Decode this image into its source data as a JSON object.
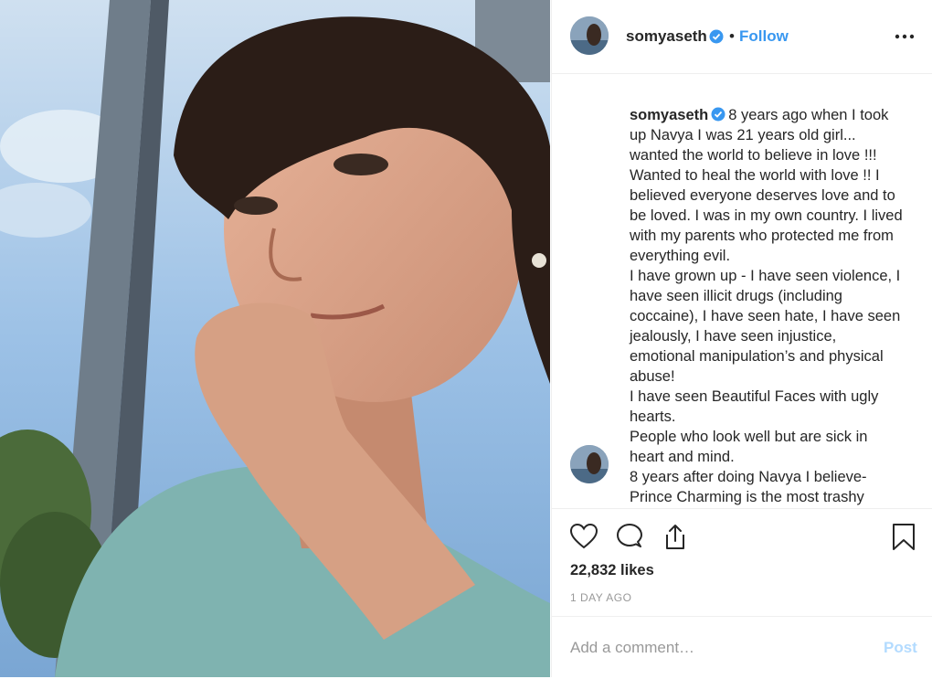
{
  "post": {
    "username": "somyaseth",
    "follow_label": "Follow",
    "separator": "•",
    "caption": "8 years ago when I took up Navya I was 21 years old girl... wanted the world to believe in love !!! Wanted to heal the world with love !! I believed everyone deserves love and to be loved. I was in my own country. I lived with my parents who protected me from everything evil.\nI have grown up - I have seen violence, I have seen illicit drugs (including coccaine), I have seen hate, I have seen jealously, I have seen injustice, emotional manipulation’s and physical abuse!\nI have seen Beautiful Faces with ugly hearts.\nPeople who look well but are sick in heart and mind.\n8 years after doing Navya I believe- Prince Charming is the most trashy",
    "likes": "22,832 likes",
    "timestamp": "1 DAY AGO"
  },
  "comment_box": {
    "placeholder": "Add a comment…",
    "post_label": "Post"
  },
  "colors": {
    "accent": "#3897f0",
    "post_disabled": "#b3dbff",
    "muted": "#999999",
    "text": "#262626"
  },
  "icons": {
    "more": "more-options-icon",
    "like": "heart-icon",
    "comment": "comment-icon",
    "share": "share-icon",
    "save": "bookmark-icon",
    "verified": "verified-badge-icon"
  }
}
